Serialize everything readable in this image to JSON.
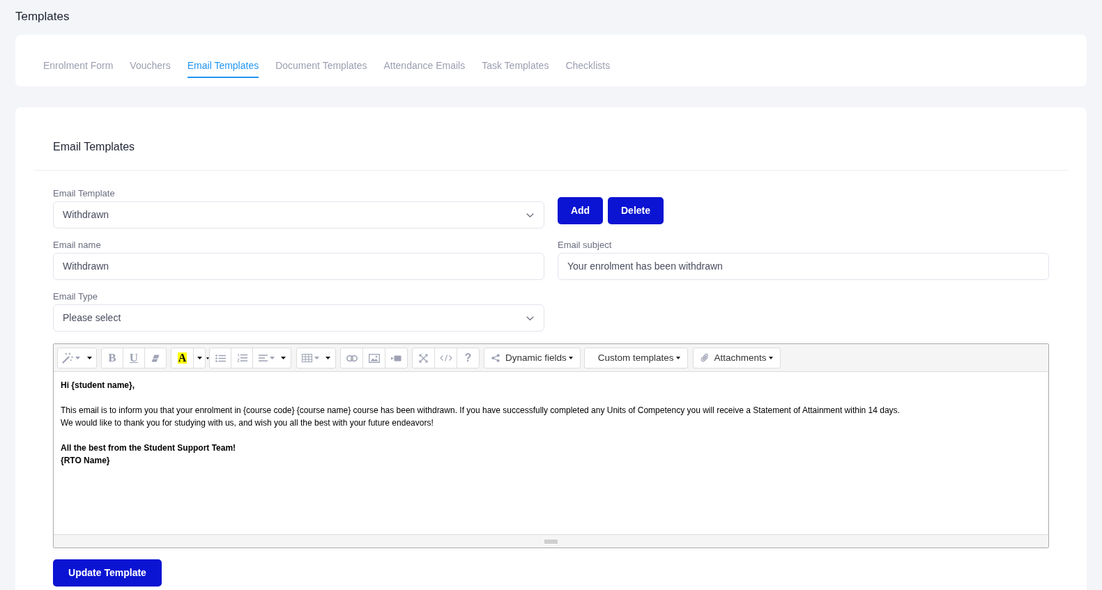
{
  "page": {
    "title": "Templates"
  },
  "tabs": [
    {
      "label": "Enrolment Form",
      "selected": false
    },
    {
      "label": "Vouchers",
      "selected": false
    },
    {
      "label": "Email Templates",
      "selected": true
    },
    {
      "label": "Document Templates",
      "selected": false
    },
    {
      "label": "Attendance Emails",
      "selected": false
    },
    {
      "label": "Task Templates",
      "selected": false
    },
    {
      "label": "Checklists",
      "selected": false
    }
  ],
  "panel": {
    "title": "Email Templates"
  },
  "form": {
    "email_template": {
      "label": "Email Template",
      "value": "Withdrawn"
    },
    "actions": [
      "Add",
      "Delete"
    ],
    "email_name": {
      "label": "Email name",
      "value": "Withdrawn"
    },
    "email_subject": {
      "label": "Email subject",
      "value": "Your enrolment has been withdrawn"
    },
    "email_type": {
      "label": "Email Type",
      "value": "Please select"
    }
  },
  "editor": {
    "toolbar": {
      "bold": "B",
      "underline": "U",
      "highlight": "A",
      "help": "?"
    },
    "menus": [
      "Dynamic fields",
      "Custom templates",
      "Attachments"
    ],
    "body": [
      {
        "bold": true,
        "lines": [
          "Hi {student name},"
        ]
      },
      {
        "bold": false,
        "lines": [
          "This email is to inform you that your enrolment in {course code} {course name} course has been withdrawn. If you have successfully completed any Units of Competency you will receive a Statement of Attainment within 14 days.",
          "We would like to thank you for studying with us, and wish you all the best with your future endeavors!"
        ]
      },
      {
        "bold": true,
        "lines": [
          "All the best from the Student Support Team!",
          "{RTO Name}"
        ]
      }
    ]
  },
  "submit_button": "Update Template"
}
